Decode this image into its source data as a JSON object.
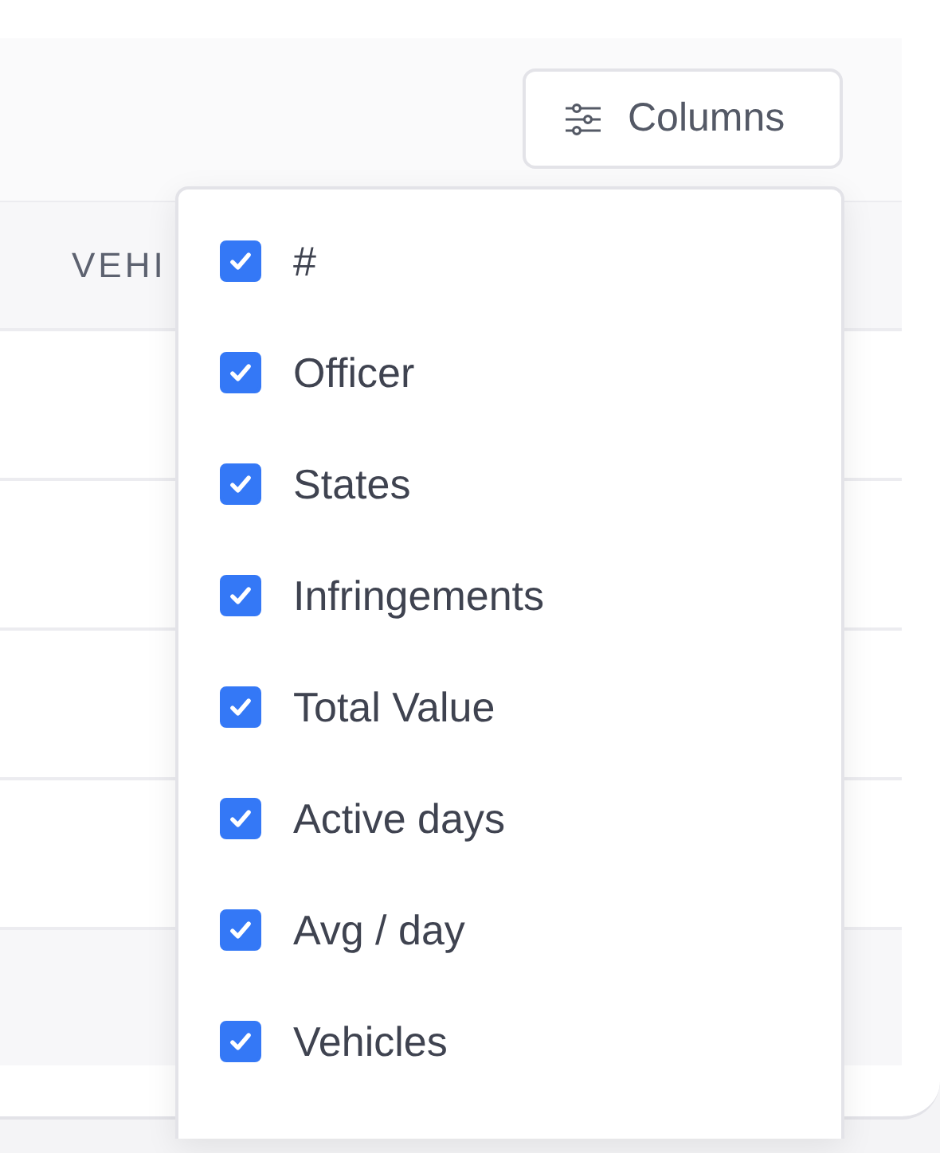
{
  "toolbar": {
    "columns_button": {
      "label": "Columns"
    }
  },
  "table": {
    "columns": [
      "VEHI"
    ]
  },
  "column_menu": {
    "items": [
      {
        "label": "#",
        "checked": true
      },
      {
        "label": "Officer",
        "checked": true
      },
      {
        "label": "States",
        "checked": true
      },
      {
        "label": "Infringements",
        "checked": true
      },
      {
        "label": "Total Value",
        "checked": true
      },
      {
        "label": "Active days",
        "checked": true
      },
      {
        "label": "Avg / day",
        "checked": true
      },
      {
        "label": "Vehicles",
        "checked": true
      }
    ]
  }
}
